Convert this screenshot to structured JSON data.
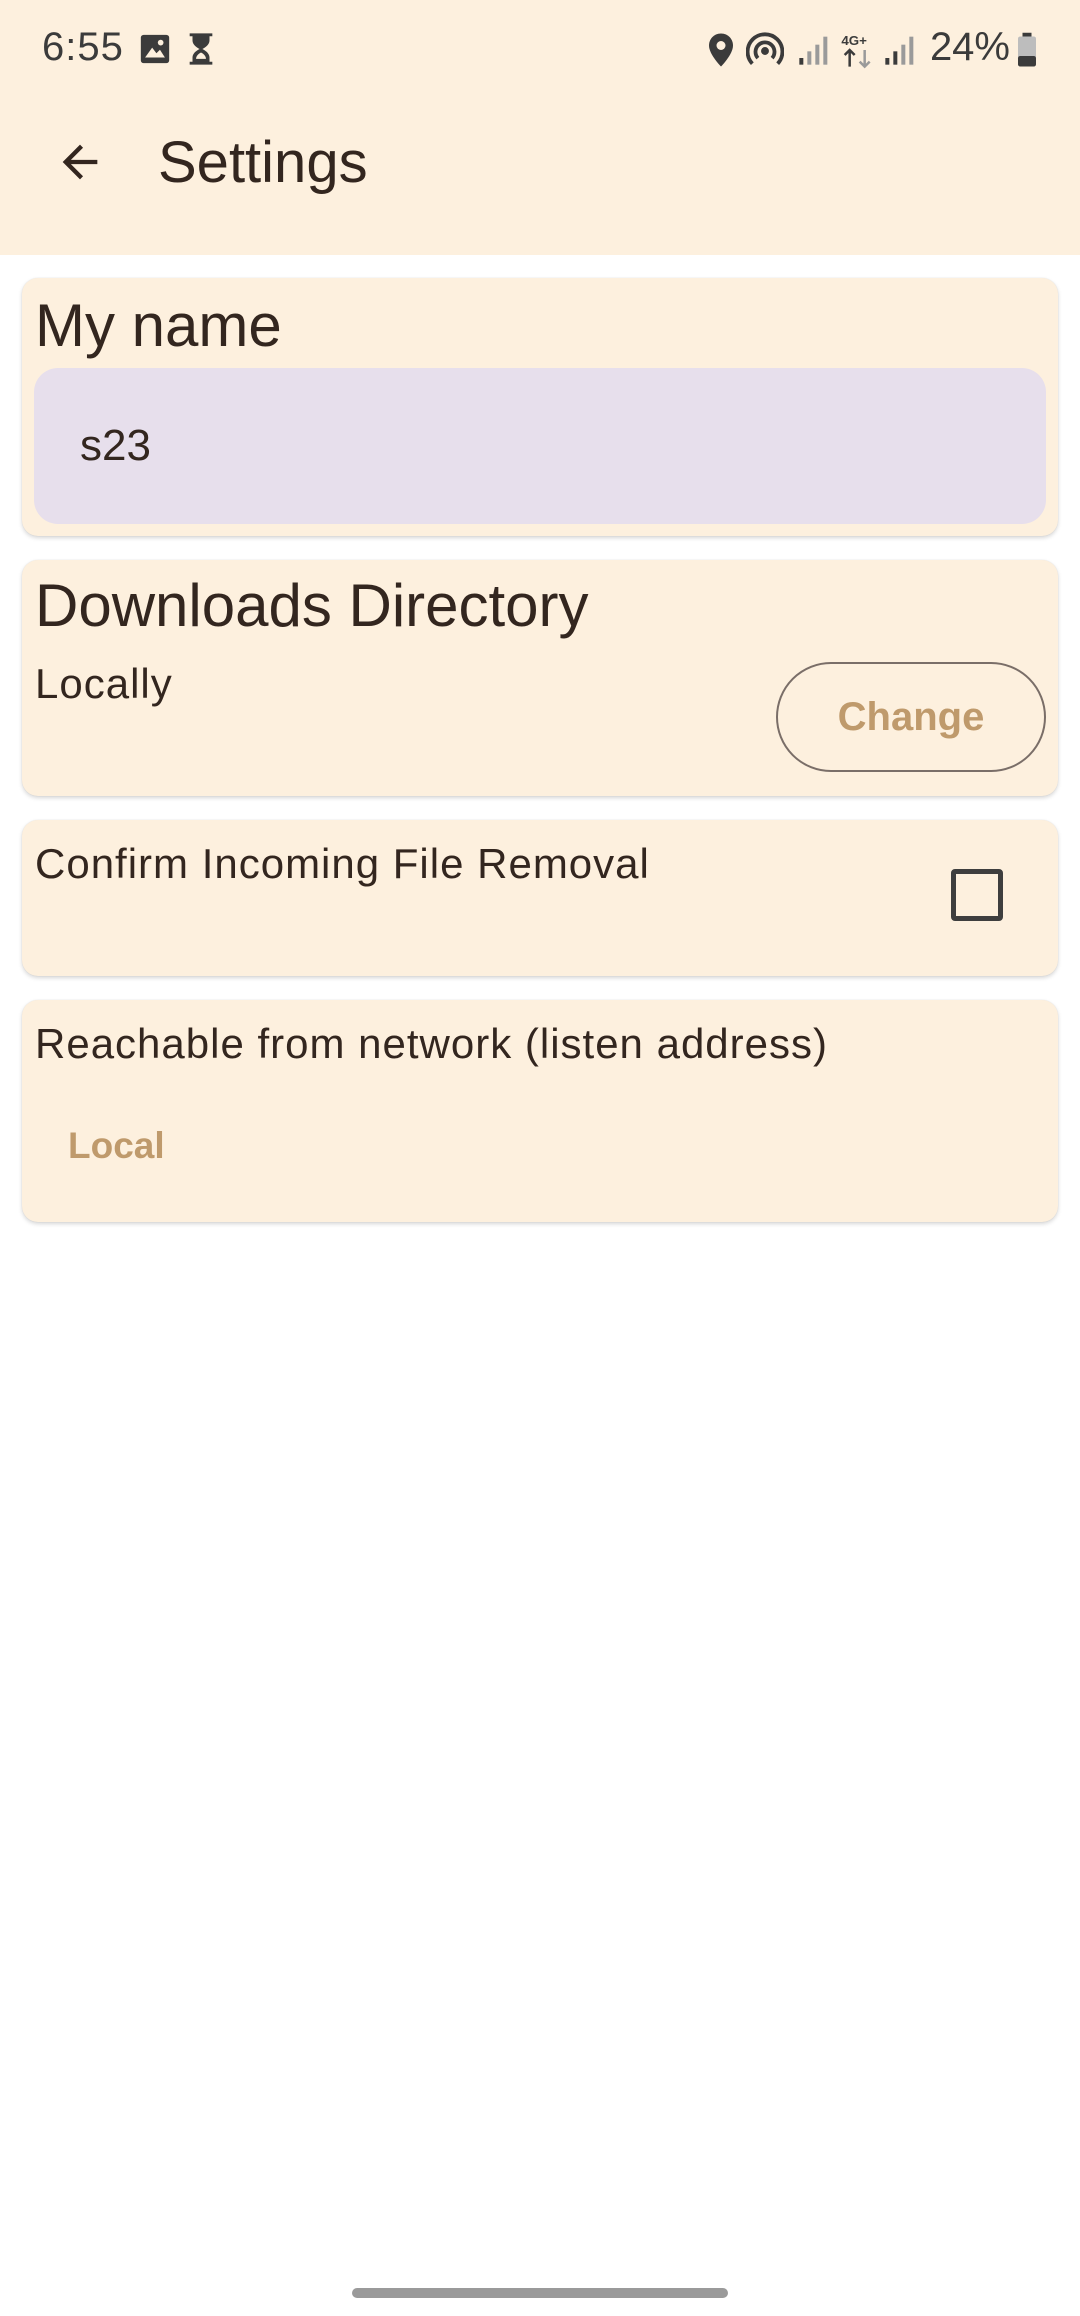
{
  "status_bar": {
    "time": "6:55",
    "battery": "24%",
    "icons": [
      "image-icon",
      "hourglass-icon",
      "location-icon",
      "hotspot-icon",
      "signal-icon",
      "data-4g-icon",
      "signal-icon",
      "battery-icon"
    ]
  },
  "app_bar": {
    "title": "Settings",
    "back_icon": "arrow-back-icon"
  },
  "my_name": {
    "title": "My name",
    "value": "s23"
  },
  "downloads": {
    "title": "Downloads Directory",
    "location": "Locally",
    "change_label": "Change"
  },
  "confirm_removal": {
    "label": "Confirm Incoming File Removal",
    "checked": false
  },
  "reachable": {
    "label": "Reachable from network (listen address)",
    "value": "Local"
  },
  "colors": {
    "background": "#fdf0de",
    "accent": "#bf9a6c",
    "text": "#33261f",
    "input_fill": "#e7dfec"
  }
}
